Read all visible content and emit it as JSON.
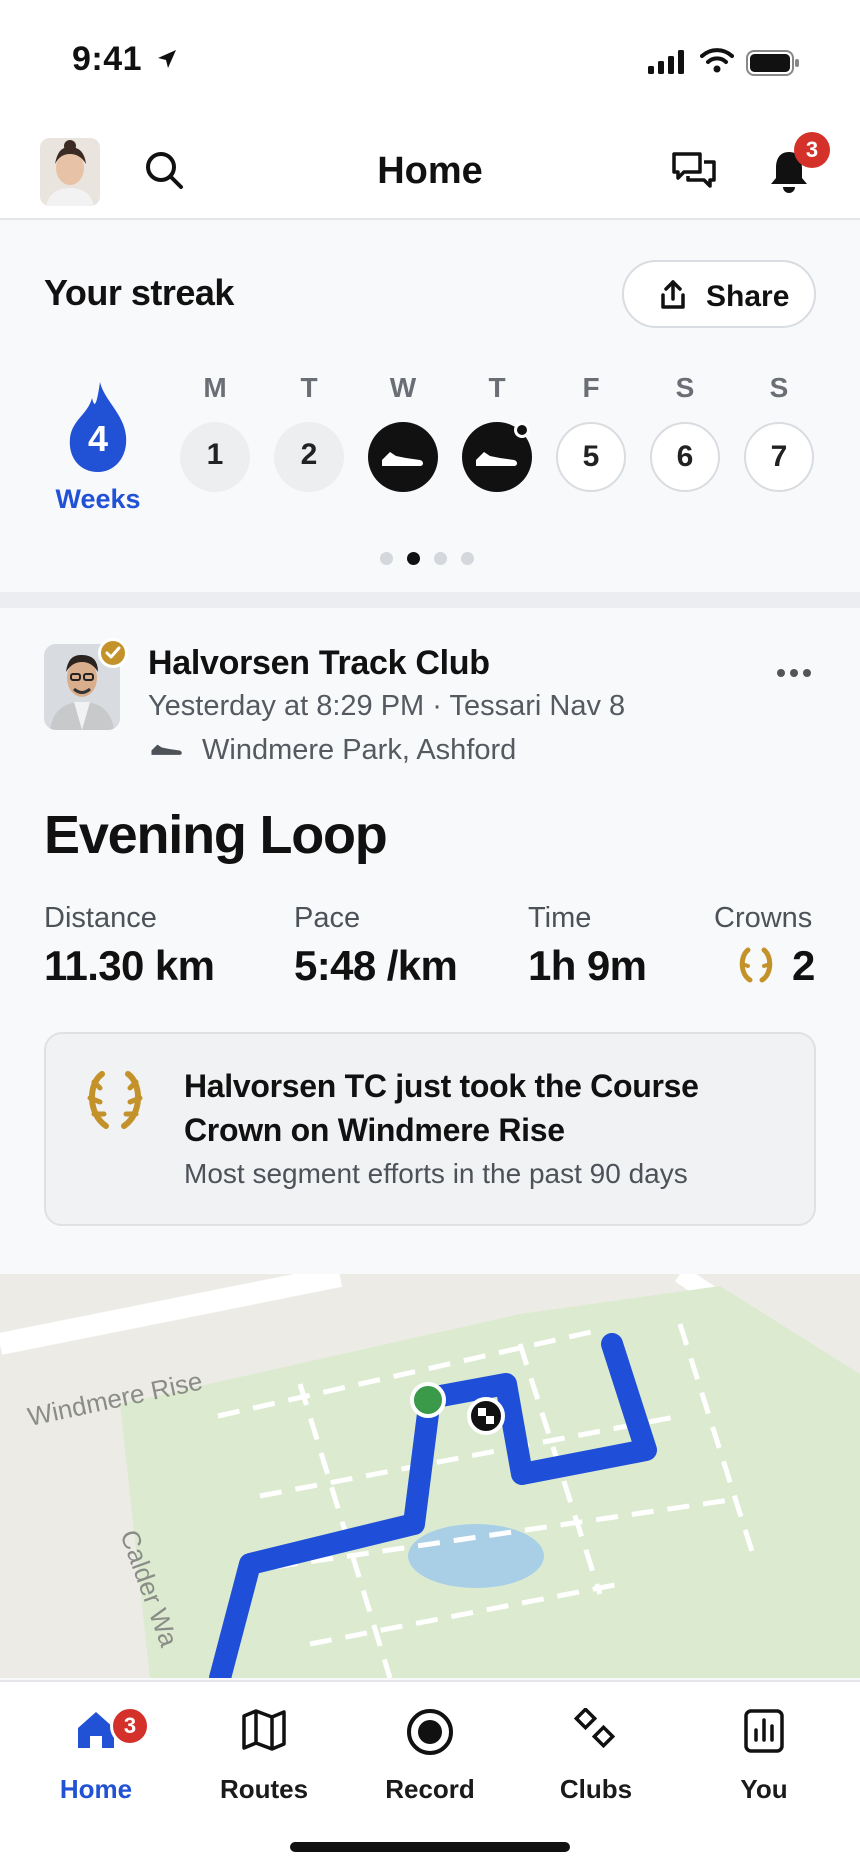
{
  "status_bar": {
    "time": "9:41"
  },
  "header": {
    "title": "Home",
    "notification_count": "3"
  },
  "streak": {
    "title": "Your streak",
    "share_label": "Share",
    "count": "4",
    "unit": "Weeks",
    "days": [
      {
        "letter": "M",
        "value": "1",
        "state": "past"
      },
      {
        "letter": "T",
        "value": "2",
        "state": "past"
      },
      {
        "letter": "W",
        "value": "",
        "state": "done"
      },
      {
        "letter": "T",
        "value": "",
        "state": "done"
      },
      {
        "letter": "F",
        "value": "5",
        "state": "future"
      },
      {
        "letter": "S",
        "value": "6",
        "state": "future"
      },
      {
        "letter": "S",
        "value": "7",
        "state": "future"
      }
    ],
    "pager": {
      "pages": 4,
      "current": 2
    }
  },
  "activity": {
    "club_name": "Halvorsen Track Club",
    "meta": "Yesterday at 8:29 PM · Tessari Nav 8",
    "location": "Windmere Park, Ashford",
    "title": "Evening Loop",
    "stats": {
      "distance_label": "Distance",
      "distance_value": "11.30 km",
      "pace_label": "Pace",
      "pace_value": "5:48 /km",
      "time_label": "Time",
      "time_value": "1h 9m",
      "crowns_label": "Crowns",
      "crowns_value": "2"
    },
    "callout": {
      "headline": "Halvorsen TC just took the Course Crown on Windmere Rise",
      "subtext": "Most segment efforts in the past 90 days"
    },
    "map": {
      "street_1": "Windmere Rise",
      "street_2": "Calder Wa",
      "route_color": "#1f4fd8",
      "start_color": "#3a9a4a",
      "park_color": "#dcebcf",
      "water_color": "#a9cfe6"
    }
  },
  "tabbar": {
    "tabs": [
      {
        "label": "Home",
        "icon": "home-icon",
        "active": true,
        "badge": "3"
      },
      {
        "label": "Routes",
        "icon": "map-icon",
        "active": false
      },
      {
        "label": "Record",
        "icon": "record-icon",
        "active": false
      },
      {
        "label": "Clubs",
        "icon": "clubs-icon",
        "active": false
      },
      {
        "label": "You",
        "icon": "stats-icon",
        "active": false
      }
    ]
  },
  "colors": {
    "accent": "#2152d6",
    "badge": "#d5312b",
    "crown_gold": "#c4922a"
  }
}
